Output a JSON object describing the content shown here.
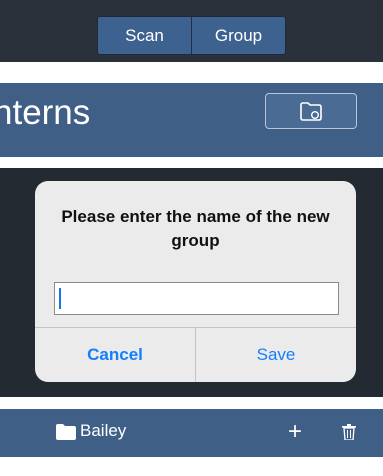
{
  "segmented_control": {
    "scan_label": "Scan",
    "group_label": "Group"
  },
  "header": {
    "title_fragment": "nterns",
    "folder_button_icon": "folder-add-icon"
  },
  "alert": {
    "message": "Please enter the name of the new group",
    "input_value": "",
    "cancel_label": "Cancel",
    "save_label": "Save"
  },
  "folder_bar": {
    "folder_name": "Bailey",
    "folder_icon": "folder-icon",
    "add_icon": "plus-icon",
    "delete_icon": "trash-icon"
  },
  "colors": {
    "bar_blue": "#3f5f86",
    "dark_bg": "#242a32",
    "ios_blue": "#157efb",
    "alert_bg": "#ebebec"
  }
}
